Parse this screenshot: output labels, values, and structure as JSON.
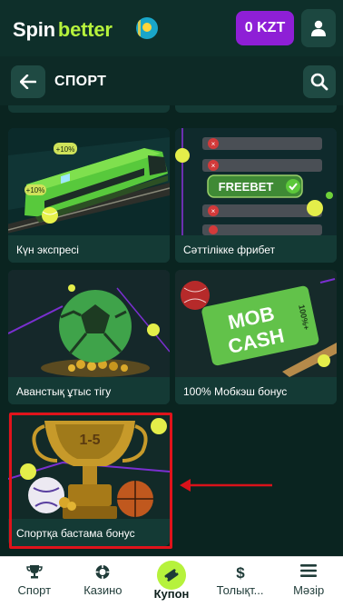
{
  "header": {
    "logo_part1": "Spin",
    "logo_part2": "better",
    "balance": "0 KZT"
  },
  "section": {
    "title": "СПОРТ"
  },
  "cards": [
    {
      "label": "Күн экспресі"
    },
    {
      "label": "Сәттілікке фрибет",
      "art_text": "FREEBET"
    },
    {
      "label": "Аванстық ұтыс тігу"
    },
    {
      "label": "100% Мобкэш бонус",
      "art_text_1": "MOB",
      "art_text_2": "CASH",
      "art_text_3": "100%+"
    },
    {
      "label": "Спортқа бастама бонус",
      "art_text": "1-5"
    }
  ],
  "train_badges": [
    "+10%",
    "+10%"
  ],
  "bottom_nav": [
    {
      "label": "Спорт",
      "icon": "trophy-icon"
    },
    {
      "label": "Казино",
      "icon": "chip-icon"
    },
    {
      "label": "Купон",
      "icon": "ticket-icon",
      "active": true
    },
    {
      "label": "Толықт...",
      "icon": "dollar-icon"
    },
    {
      "label": "Мәзір",
      "icon": "menu-icon"
    }
  ],
  "colors": {
    "brand_green": "#b6f23c",
    "balance_purple": "#8e1fd6",
    "background": "#0d2a26",
    "highlight_red": "#e0131b"
  }
}
